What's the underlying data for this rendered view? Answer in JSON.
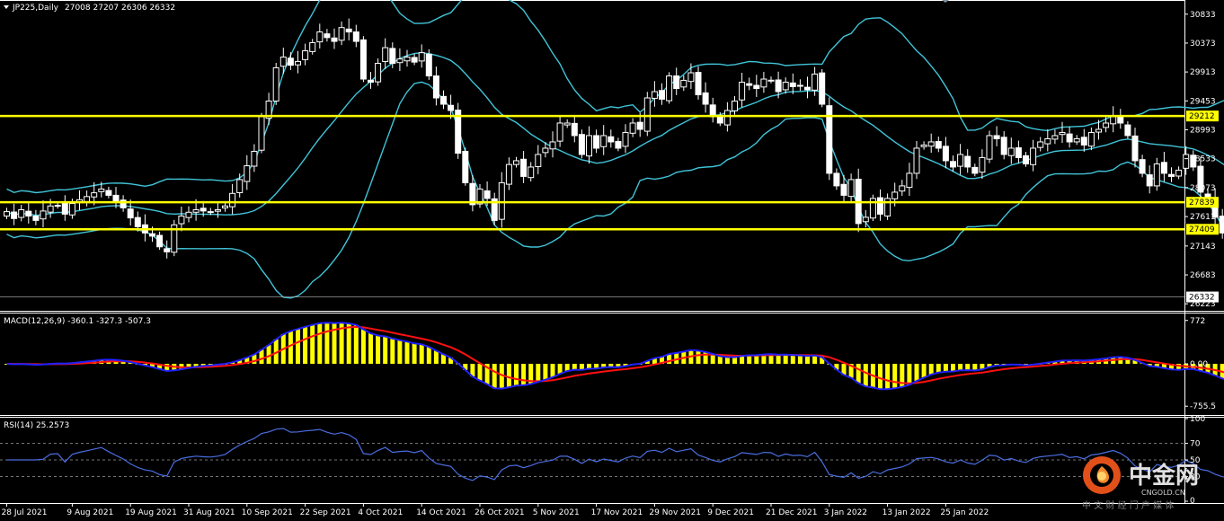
{
  "header": {
    "symbol": "JP225,Daily",
    "ohlc": "27008 27207 26306 26332"
  },
  "colors": {
    "background": "#000000",
    "grid": "#ffffff",
    "candle": "#ffffff",
    "bollinger": "#40c4d8",
    "hline": "#ffff00",
    "macd_hist": "#ffff00",
    "macd_line": "#2020ff",
    "signal_line": "#ff1010",
    "rsi_line": "#4a6ee0",
    "label_bg": "#ffff00"
  },
  "chart_data": [
    {
      "type": "candlestick",
      "title": "JP225,Daily",
      "ohlc_text": "27008 27207 26306 26332",
      "y_ticks": [
        30833,
        30373,
        29913,
        29453,
        28993,
        28533,
        28073,
        27611,
        27143,
        26683,
        26223
      ],
      "ylim": [
        26140,
        31030
      ],
      "price_labels": [
        29212,
        27839,
        27409,
        26332
      ],
      "horizontal_lines": [
        29212,
        27839,
        27409
      ],
      "x_labels": [
        "28 Jul 2021",
        "9 Aug 2021",
        "19 Aug 2021",
        "31 Aug 2021",
        "10 Sep 2021",
        "22 Sep 2021",
        "4 Oct 2021",
        "14 Oct 2021",
        "26 Oct 2021",
        "5 Nov 2021",
        "17 Nov 2021",
        "29 Nov 2021",
        "9 Dec 2021",
        "21 Dec 2021",
        "3 Jan 2022",
        "13 Jan 2022",
        "25 Jan 2022"
      ],
      "label_bar_index": [
        0,
        9,
        17,
        25,
        33,
        41,
        49,
        57,
        65,
        73,
        81,
        89,
        97,
        105,
        113,
        121,
        129
      ],
      "close": [
        27690,
        27580,
        27720,
        27620,
        27550,
        27700,
        27780,
        27790,
        27650,
        27820,
        27880,
        27930,
        27990,
        28050,
        27950,
        27850,
        27750,
        27590,
        27450,
        27350,
        27300,
        27130,
        27050,
        27480,
        27620,
        27680,
        27720,
        27700,
        27690,
        27720,
        27780,
        27980,
        28200,
        28420,
        28650,
        29200,
        29450,
        29980,
        30150,
        30020,
        30080,
        30250,
        30380,
        30550,
        30460,
        30400,
        30620,
        30550,
        30400,
        29800,
        29750,
        30050,
        30300,
        30050,
        30120,
        30150,
        30070,
        30220,
        29850,
        29500,
        29400,
        29300,
        28620,
        28150,
        27800,
        28050,
        27900,
        27550,
        28150,
        28440,
        28500,
        28250,
        28400,
        28600,
        28700,
        28800,
        29100,
        29100,
        28900,
        28600,
        28900,
        28700,
        28900,
        28800,
        28700,
        28950,
        29100,
        29000,
        29500,
        29600,
        29480,
        29850,
        29650,
        29780,
        29900,
        29550,
        29400,
        29200,
        29100,
        29300,
        29450,
        29750,
        29700,
        29650,
        29800,
        29780,
        29600,
        29750,
        29680,
        29700,
        29630,
        29880,
        29400,
        28300,
        28100,
        27950,
        28200,
        27500,
        27600,
        27900,
        27650,
        27900,
        28000,
        28100,
        28300,
        28700,
        28750,
        28800,
        28700,
        28500,
        28400,
        28600,
        28400,
        28300,
        28550,
        28900,
        28850,
        28600,
        28700,
        28550,
        28450,
        28700,
        28800,
        28850,
        28900,
        28950,
        28800,
        28850,
        28750,
        28950,
        29000,
        29100,
        29200,
        29100,
        28900,
        28500,
        28300,
        28100,
        28450,
        28300,
        28250,
        28350,
        28600,
        28400,
        28000,
        27900,
        27600,
        27350,
        27250,
        27150,
        27300,
        27050,
        27000,
        26800,
        26950,
        26332
      ]
    },
    {
      "type": "macd",
      "title": "MACD(12,26,9) -360.1 -327.3 -507.3",
      "params": "12,26,9",
      "values": [
        -360.1,
        -327.3,
        -507.3
      ],
      "y_ticks": [
        "772",
        "0.00",
        "-755.5"
      ],
      "ylim": [
        -880,
        880
      ]
    },
    {
      "type": "rsi",
      "title": "RSI(14) 25.2573",
      "period": 14,
      "value": 25.2573,
      "y_ticks": [
        100,
        70,
        50,
        30,
        0
      ],
      "levels": [
        70,
        50,
        30
      ],
      "ylim": [
        0,
        100
      ]
    }
  ],
  "watermark": {
    "brand": "中金网",
    "domain": "CNGOLD.CN",
    "tagline": "中 文 财 经 门 户 媒 体"
  },
  "icons": {
    "collapse": "triangle-down-icon",
    "logo": "cngold-logo-icon"
  }
}
